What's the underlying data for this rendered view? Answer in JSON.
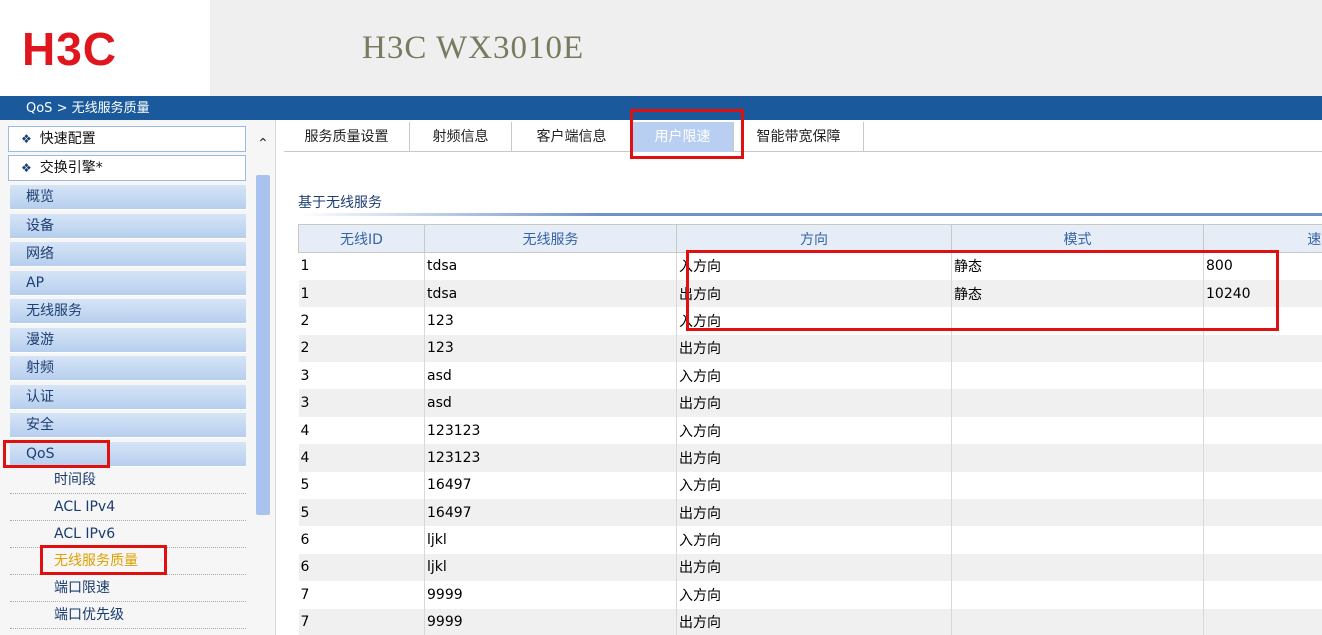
{
  "header": {
    "logo": "H3C",
    "product": "H3C WX3010E"
  },
  "breadcrumb": "QoS > 无线服务质量",
  "sidebar": {
    "top_items": [
      "快速配置",
      "交换引擎*"
    ],
    "menu_items": [
      "概览",
      "设备",
      "网络",
      "AP",
      "无线服务",
      "漫游",
      "射频",
      "认证",
      "安全",
      "QoS"
    ],
    "sub_items": [
      "时间段",
      "ACL IPv4",
      "ACL IPv6",
      "无线服务质量",
      "端口限速",
      "端口优先级"
    ],
    "active_sub": "无线服务质量",
    "scroll_up_glyph": "⌃"
  },
  "tabs": [
    "服务质量设置",
    "射频信息",
    "客户端信息",
    "用户限速",
    "智能带宽保障"
  ],
  "active_tab": "用户限速",
  "section_title": "基于无线服务",
  "table": {
    "columns": [
      "无线ID",
      "无线服务",
      "方向",
      "模式",
      "速率(千"
    ],
    "rows": [
      [
        "1",
        "tdsa",
        "入方向",
        "静态",
        "800"
      ],
      [
        "1",
        "tdsa",
        "出方向",
        "静态",
        "10240"
      ],
      [
        "2",
        "123",
        "入方向",
        "",
        ""
      ],
      [
        "2",
        "123",
        "出方向",
        "",
        ""
      ],
      [
        "3",
        "asd",
        "入方向",
        "",
        ""
      ],
      [
        "3",
        "asd",
        "出方向",
        "",
        ""
      ],
      [
        "4",
        "123123",
        "入方向",
        "",
        ""
      ],
      [
        "4",
        "123123",
        "出方向",
        "",
        ""
      ],
      [
        "5",
        "16497",
        "入方向",
        "",
        ""
      ],
      [
        "5",
        "16497",
        "出方向",
        "",
        ""
      ],
      [
        "6",
        "ljkl",
        "入方向",
        "",
        ""
      ],
      [
        "6",
        "ljkl",
        "出方向",
        "",
        ""
      ],
      [
        "7",
        "9999",
        "入方向",
        "",
        ""
      ],
      [
        "7",
        "9999",
        "出方向",
        "",
        ""
      ]
    ]
  },
  "colors": {
    "brand_red": "#e0161f",
    "breadcrumb_bar": "#1a5a9c",
    "highlight_box": "#e01010"
  }
}
